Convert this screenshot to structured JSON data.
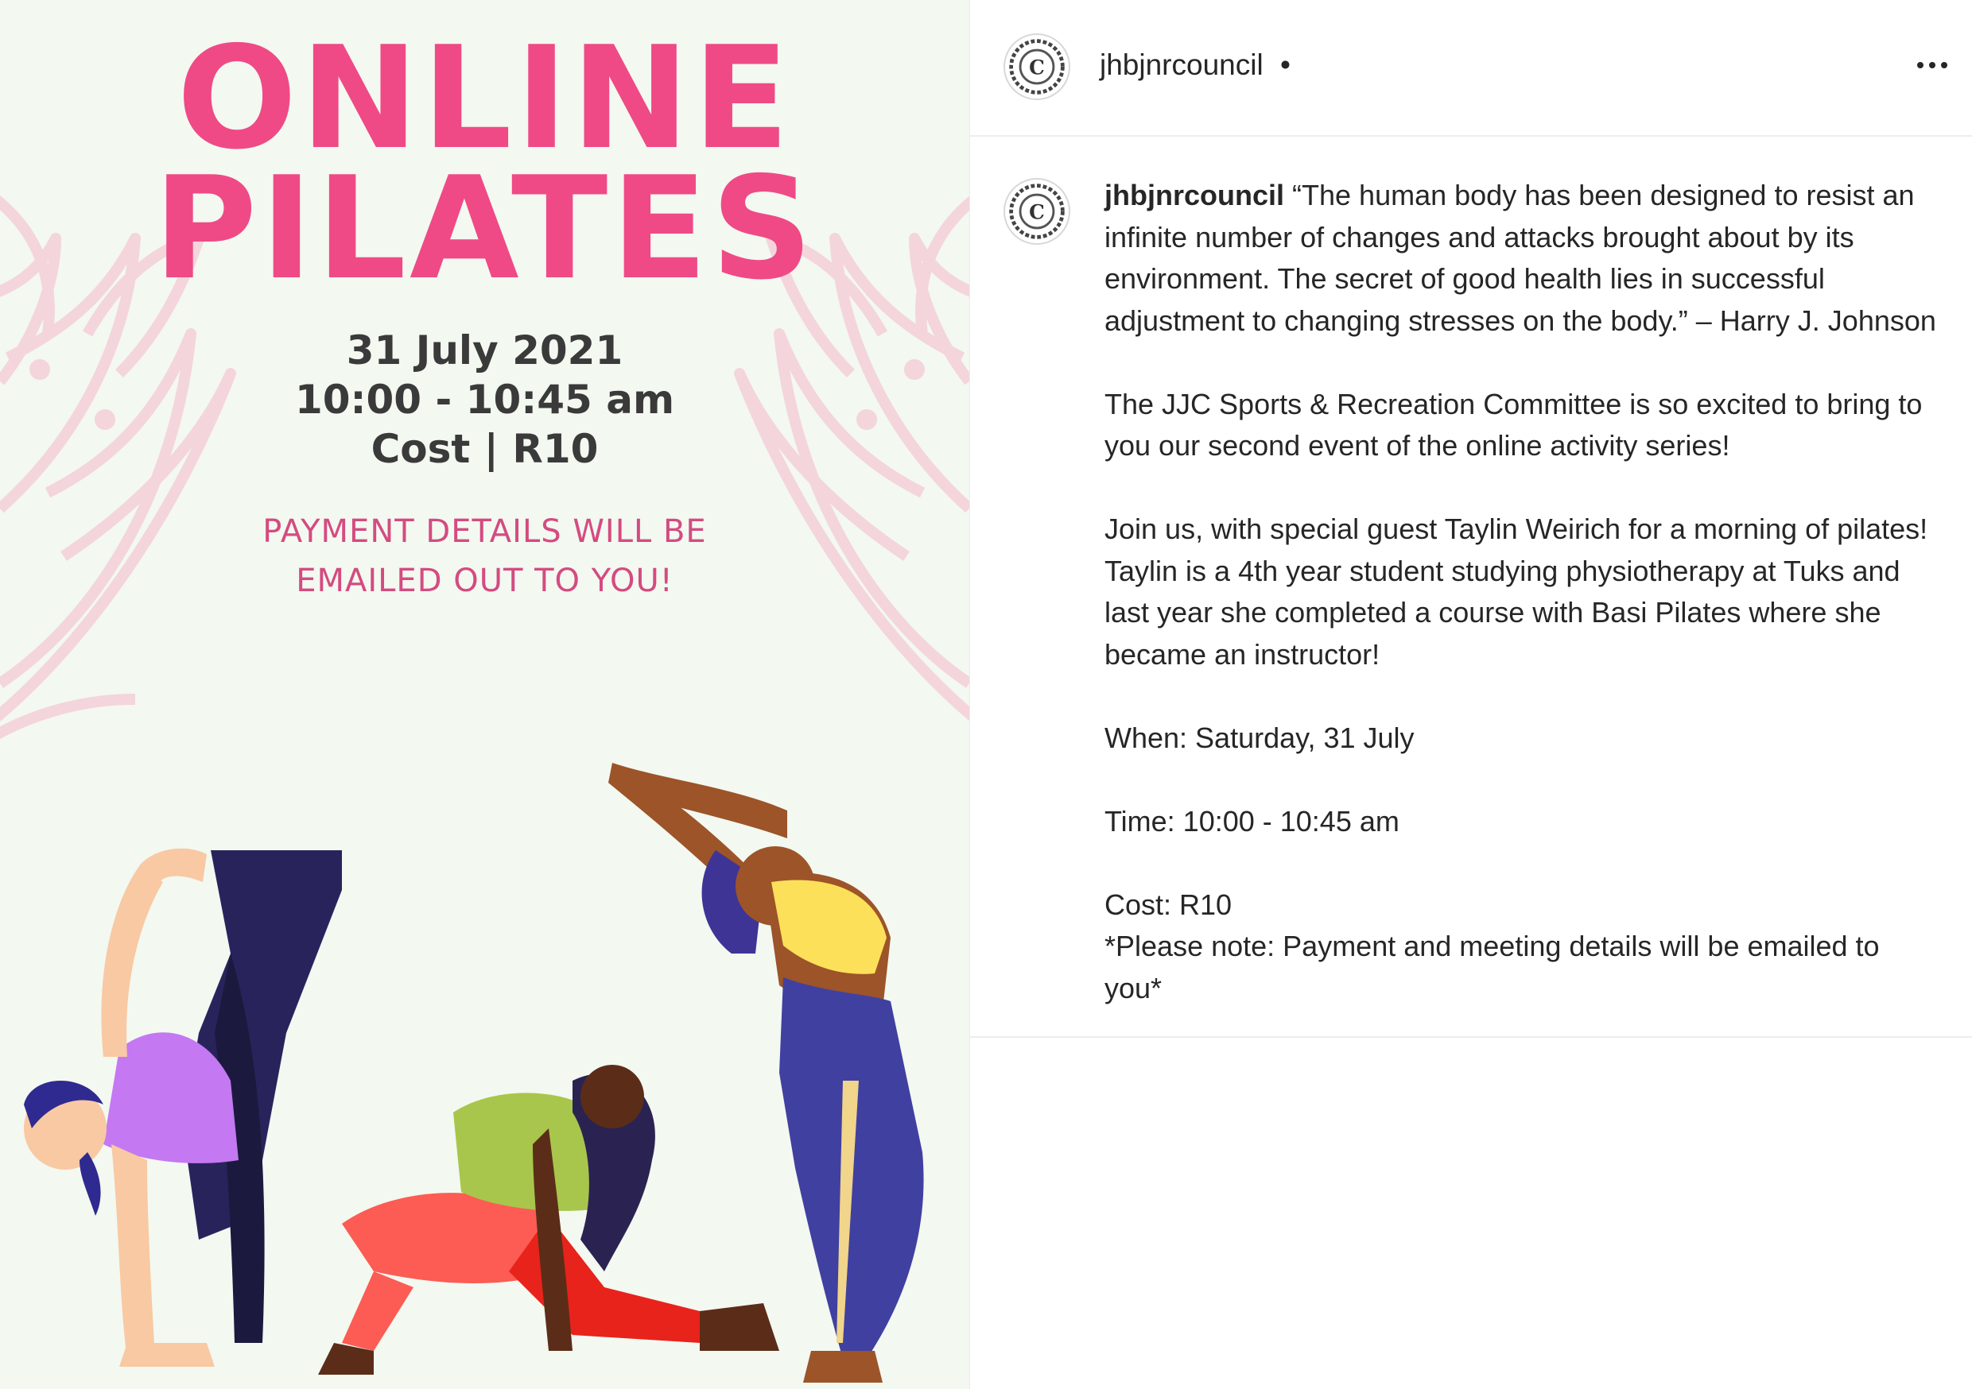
{
  "poster": {
    "title_line1": "ONLINE",
    "title_line2": "PILATES",
    "date": "31 July 2021",
    "time": "10:00 - 10:45 am",
    "cost": "Cost | R10",
    "note_line1": "PAYMENT DETAILS WILL BE",
    "note_line2": "EMAILED OUT TO YOU!",
    "colors": {
      "background": "#f3f8f1",
      "title": "#ef4a86",
      "info": "#3a3a3a",
      "note": "#d44b80",
      "flower_outline": "#f4d5dc"
    }
  },
  "header": {
    "avatar_icon": "council-logo-icon",
    "username": "jhbjnrcouncil",
    "separator": "•",
    "more_icon": "more-options-icon"
  },
  "caption": {
    "avatar_icon": "council-logo-icon",
    "username": "jhbjnrcouncil",
    "lines": [
      "“The human body has been designed to resist an",
      "infinite number of changes and attacks brought about by its",
      "environment. The secret of good health lies in successful",
      "adjustment to changing stresses on the body.” – Harry J. Johnson",
      "",
      "The JJC Sports & Recreation Committee is so excited to bring to",
      "you our second event of the online activity series!",
      "",
      "Join us, with special guest Taylin Weirich for a morning of pilates!",
      "Taylin is a 4th year student studying physiotherapy at Tuks and",
      "last year she completed a course with Basi Pilates where she",
      "became an instructor!",
      "",
      "When: Saturday, 31 July",
      "",
      "Time: 10:00 - 10:45 am",
      "",
      "Cost: R10",
      "*Please note: Payment and meeting details will be emailed to",
      "you*"
    ]
  }
}
